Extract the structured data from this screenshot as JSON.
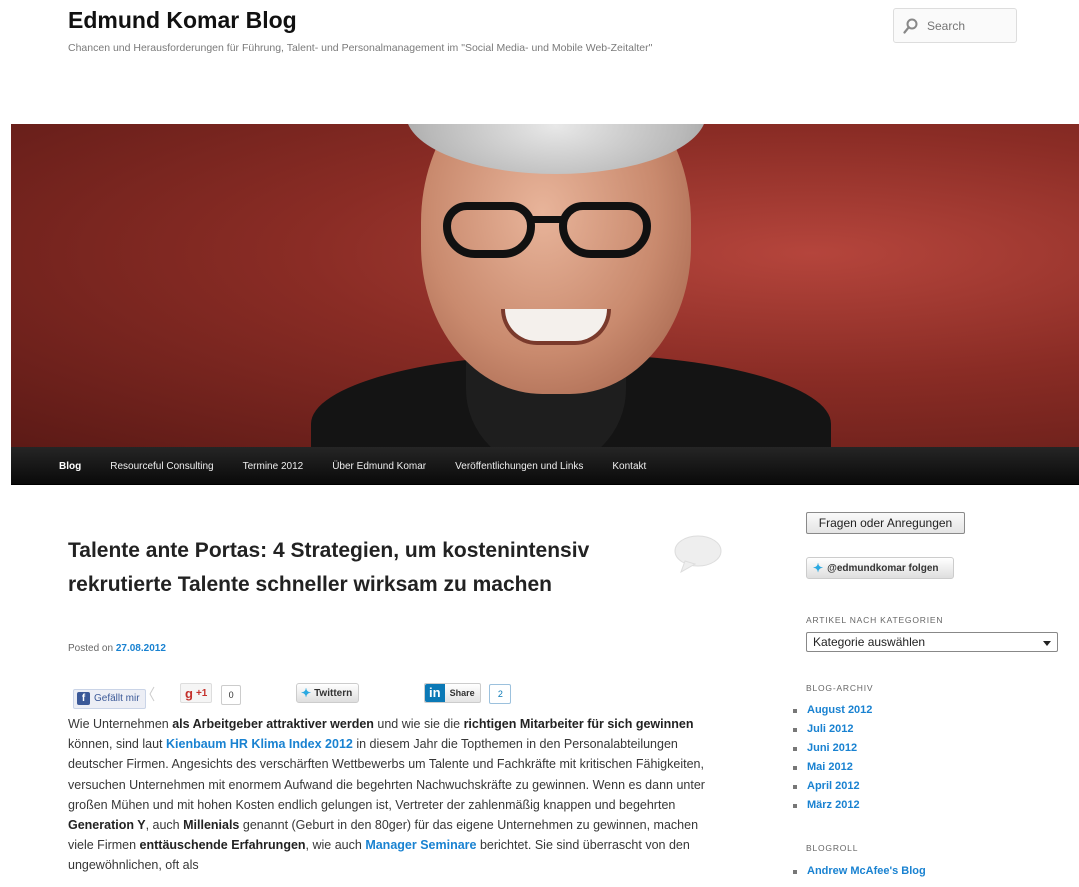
{
  "site": {
    "title": "Edmund Komar Blog",
    "description": "Chancen und Herausforderungen für Führung, Talent- und Personalmanagement im \"Social Media- und Mobile Web-Zeitalter\""
  },
  "search": {
    "placeholder": "Search"
  },
  "nav": {
    "items": [
      "Blog",
      "Resourceful Consulting",
      "Termine 2012",
      "Über Edmund Komar",
      "Veröffentlichungen und Links",
      "Kontakt"
    ]
  },
  "post": {
    "title": "Talente ante Portas: 4 Strategien, um kostenintensiv rekrutierte Talente schneller wirksam zu machen",
    "posted_prefix": "Posted on",
    "date": "27.08.2012",
    "share": {
      "facebook_label": "Gefällt mir",
      "gplus_label": "+1",
      "gplus_count": "0",
      "twitter_label": "Twittern",
      "linkedin_label": "Share",
      "linkedin_count": "2"
    },
    "body": [
      {
        "t": "Wie Unternehmen "
      },
      {
        "b": "als Arbeitgeber attraktiver werden"
      },
      {
        "t": " und wie sie die "
      },
      {
        "b": "richtigen Mitarbeiter für sich gewinnen"
      },
      {
        "t": " können, sind laut "
      },
      {
        "a": "Kienbaum HR Klima Index 2012"
      },
      {
        "t": " in diesem Jahr die Topthemen in den Personalabteilungen deutscher Firmen. Angesichts des verschärften Wettbewerbs um Talente und Fachkräfte mit kritischen Fähigkeiten, versuchen Unternehmen mit enormem Aufwand die begehrten Nachwuchskräfte zu gewinnen. Wenn es dann unter großen Mühen und mit hohen Kosten endlich gelungen ist, Vertreter der zahlenmäßig knappen und begehrten "
      },
      {
        "b": "Generation Y"
      },
      {
        "t": ", auch "
      },
      {
        "b": "Millenials"
      },
      {
        "t": " genannt (Geburt in den 80ger) für das eigene Unternehmen zu gewinnen, machen viele Firmen "
      },
      {
        "b": "enttäuschende Erfahrungen"
      },
      {
        "t": ", wie auch "
      },
      {
        "a": "Manager Seminare"
      },
      {
        "t": " berichtet. Sie sind überrascht von den ungewöhnlichen, oft als"
      }
    ]
  },
  "sidebar": {
    "feedback_button": "Fragen oder Anregungen",
    "twitter_follow": "@edmundkomar folgen",
    "categories_title": "ARTIKEL NACH KATEGORIEN",
    "categories_selected": "Kategorie auswählen",
    "archive_title": "BLOG-ARCHIV",
    "archive": [
      "August 2012",
      "Juli 2012",
      "Juni 2012",
      "Mai 2012",
      "April 2012",
      "März 2012"
    ],
    "blogroll_title": "BLOGROLL",
    "blogroll": [
      "Andrew McAfee's Blog"
    ]
  },
  "colors": {
    "link": "#1982d1",
    "nav_bg": "#111111",
    "banner_bg": "#8a2c25"
  }
}
